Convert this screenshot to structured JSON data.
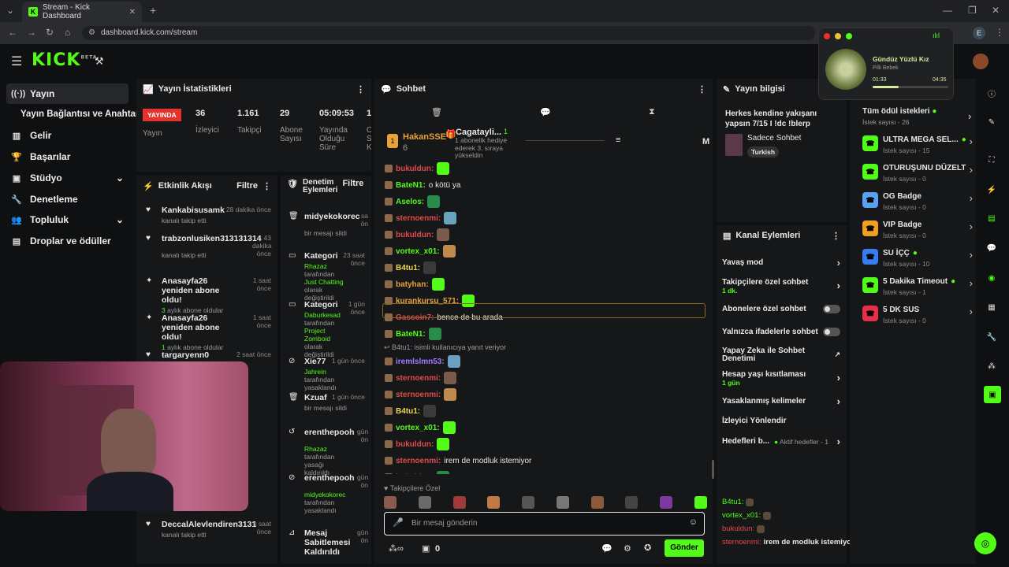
{
  "browser": {
    "tab_title": "Stream - Kick Dashboard",
    "url": "dashboard.kick.com/stream",
    "profile": "E"
  },
  "logo": {
    "text": "KICK",
    "beta": "BETA"
  },
  "sidebar": {
    "items": [
      {
        "label": "Yayın",
        "icon": "broadcast-icon"
      },
      {
        "label": "Yayın Bağlantısı ve Anahtarı",
        "icon": ""
      },
      {
        "label": "Gelir",
        "icon": "chart-icon"
      },
      {
        "label": "Başarılar",
        "icon": "trophy-icon"
      },
      {
        "label": "Stüdyo",
        "icon": "studio-icon"
      },
      {
        "label": "Denetleme",
        "icon": "wrench-icon"
      },
      {
        "label": "Topluluk",
        "icon": "users-icon"
      },
      {
        "label": "Droplar ve ödüller",
        "icon": "gift-icon"
      }
    ]
  },
  "stats": {
    "title": "Yayın İstatistikleri",
    "live": "YAYINDA",
    "live_sub": "Yayın",
    "items": [
      {
        "value": "36",
        "label": "İzleyici"
      },
      {
        "value": "1.161",
        "label": "Takipçi"
      },
      {
        "value": "29",
        "label": "Abone Sayısı"
      },
      {
        "value": "05:09:53",
        "label": "Yayında Olduğu Süre"
      },
      {
        "value": "1",
        "label": "C S K"
      }
    ]
  },
  "activity": {
    "title": "Etkinlik Akışı",
    "filter": "Filtre",
    "items": [
      {
        "name": "Kankabisusamk",
        "when": "28 dakika önce",
        "text": "kanalı takip etti",
        "type": "follow"
      },
      {
        "name": "trabzonlusiken313131314",
        "when": "43 dakika önce",
        "text": "kanalı takip etti",
        "type": "follow"
      },
      {
        "name": "Anasayfa26 yeniden abone oldu!",
        "when": "1 saat önce",
        "num": "3",
        "text": "aylık abone oldular",
        "type": "sub"
      },
      {
        "name": "Anasayfa26 yeniden abone oldu!",
        "when": "1 saat önce",
        "num": "1",
        "text": "aylık abone oldular",
        "type": "sub"
      },
      {
        "name": "targaryenn0",
        "when": "2 saat önce",
        "text": "",
        "type": "follow"
      },
      {
        "name": "DeccalAlevlendiren3131",
        "when": "4 saat önce",
        "text": "kanalı takip etti",
        "type": "follow"
      }
    ]
  },
  "moderation": {
    "title": "Denetim Eylemleri",
    "filter": "Filtre",
    "items": [
      {
        "name": "midyekokorec",
        "when": "sa ön",
        "text": "bir mesajı sildi"
      },
      {
        "name": "Kategori",
        "when": "23 saat önce",
        "actor": "Rhazaz",
        "mid": "tarafından",
        "hl": "Just Chatting",
        "tail": "olarak değiştirildi"
      },
      {
        "name": "Kategori",
        "when": "1 gün önce",
        "actor": "Daburkesad",
        "mid": "tarafından",
        "hl": "Project Zomboid",
        "tail": "olarak değiştirildi"
      },
      {
        "name": "Xie77",
        "when": "1 gün önce",
        "actor": "Jahrein",
        "tail": "tarafından yasaklandı"
      },
      {
        "name": "Kzuaf",
        "when": "1 gün önce",
        "text": "bir mesajı sildi"
      },
      {
        "name": "erenthepooh",
        "when": "gün ön",
        "actor": "Rhazaz",
        "tail": "tarafından yasağı kaldırıldı"
      },
      {
        "name": "erenthepooh",
        "when": "gün ön",
        "actor": "midyekokorec",
        "tail": "tarafından yasaklandı"
      },
      {
        "name": "Mesaj Sabitlemesi Kaldırıldı",
        "when": "gün ön",
        "text": ""
      }
    ]
  },
  "chat": {
    "title": "Sohbet",
    "pinned": {
      "user": "HakanSSE",
      "count": "6",
      "gift_user": "Cagatayli...",
      "gift_count": "1",
      "gift_text": "1 abonelik hediye ederek 3. sıraya yükseldin",
      "side": "M"
    },
    "messages": [
      {
        "user": "bukuldun",
        "color": "#e24a4a",
        "text": ""
      },
      {
        "user": "BateN1",
        "color": "#53fc18",
        "text": "o kötü ya"
      },
      {
        "user": "Aselos",
        "color": "#53fc18",
        "text": ""
      },
      {
        "user": "sternoenmi",
        "color": "#e24a4a",
        "text": ""
      },
      {
        "user": "bukuldun",
        "color": "#e24a4a",
        "text": ""
      },
      {
        "user": "vortex_x01",
        "color": "#53fc18",
        "text": ""
      },
      {
        "user": "B4tu1",
        "color": "#e8d94a",
        "text": ""
      },
      {
        "user": "batyhan",
        "color": "#e8a23a",
        "text": ""
      },
      {
        "user": "kurankursu_571",
        "color": "#e8a23a",
        "text": ""
      },
      {
        "user": "Gascoin7",
        "color": "#e24a4a",
        "text": "bence de bu arada"
      },
      {
        "user": "BateN1",
        "color": "#53fc18",
        "text": ""
      },
      {
        "user": "iremlslmn53",
        "color": "#a27cff",
        "text": ""
      },
      {
        "user": "sternoenmi",
        "color": "#e24a4a",
        "text": ""
      },
      {
        "user": "sternoenmi",
        "color": "#e24a4a",
        "text": ""
      },
      {
        "user": "B4tu1",
        "color": "#e8d94a",
        "text": ""
      },
      {
        "user": "vortex_x01",
        "color": "#53fc18",
        "text": ""
      },
      {
        "user": "bukuldun",
        "color": "#e24a4a",
        "text": ""
      },
      {
        "user": "sternoenmi",
        "color": "#e24a4a",
        "text": "irem de modluk istemiyor"
      },
      {
        "user": "bukuldun",
        "color": "#e24a4a",
        "text": ""
      }
    ],
    "reply_note": "B4tu1: isimli kullanıcıya yanıt veriyor",
    "followers_only": "Takipçilere Özel",
    "input_placeholder": "Bir mesaj gönderin",
    "points": "0",
    "send": "Gönder"
  },
  "stream_info": {
    "title": "Yayın bilgisi",
    "stream_title": "Herkes kendine yakışanı yapsın 7/15 I !dc !blerp",
    "category": "Sadece Sohbet",
    "tag": "Turkish"
  },
  "channel_actions": {
    "title": "Kanal Eylemleri",
    "items": [
      {
        "label": "Yavaş mod",
        "kind": "arrow"
      },
      {
        "label": "Takipçilere özel sohbet",
        "sub": "1 dk.",
        "kind": "arrow"
      },
      {
        "label": "Abonelere özel sohbet",
        "kind": "toggle"
      },
      {
        "label": "Yalnızca ifadelerle sohbet",
        "kind": "toggle"
      },
      {
        "label": "Yapay Zeka ile Sohbet Denetimi",
        "kind": "ext"
      },
      {
        "label": "Hesap yaşı kısıtlaması",
        "sub": "1 gün",
        "kind": "arrow"
      },
      {
        "label": "Yasaklanmış kelimeler",
        "kind": "arrow"
      },
      {
        "label": "İzleyici Yönlendir",
        "kind": "none"
      },
      {
        "label": "Hedefleri b...",
        "sub": "Aktif hedefler - 1",
        "kind": "arrow"
      }
    ]
  },
  "rewards": {
    "title": "Tüm ödül istekleri",
    "title_sub": "İstek sayısı - 26",
    "items": [
      {
        "name": "ULTRA MEGA SEL...",
        "sub": "İstek sayısı - 15",
        "color": "#53fc18",
        "dot": true
      },
      {
        "name": "OTURUŞUNU DÜZELT",
        "sub": "İstek sayısı - 0",
        "color": "#53fc18",
        "dot": false
      },
      {
        "name": "OG Badge",
        "sub": "İstek sayısı - 0",
        "color": "#5aa0f0",
        "dot": false
      },
      {
        "name": "VIP Badge",
        "sub": "İstek sayısı - 0",
        "color": "#f0a020",
        "dot": false
      },
      {
        "name": "SU İÇÇ",
        "sub": "İstek sayısı - 10",
        "color": "#3a7cf0",
        "dot": true
      },
      {
        "name": "5 Dakika Timeout",
        "sub": "İstek sayısı - 1",
        "color": "#53fc18",
        "dot": true
      },
      {
        "name": "5 DK SUS",
        "sub": "İstek sayısı - 0",
        "color": "#e0304a",
        "dot": false
      }
    ]
  },
  "music": {
    "title": "Gündüz Yüzlü Kız",
    "artist": "Pilli Bebek",
    "elapsed": "01:33",
    "total": "04:35",
    "progress": 0.34
  },
  "overlay_chat": [
    {
      "user": "B4tu1:",
      "color": "#53fc18",
      "text": ""
    },
    {
      "user": "vortex_x01:",
      "color": "#53fc18",
      "text": ""
    },
    {
      "user": "bukuldun:",
      "color": "#e24a4a",
      "text": ""
    },
    {
      "user": "sternoenmi:",
      "color": "#e24a4a",
      "text": "irem de modluk istemiyor"
    }
  ],
  "colors": {
    "accent": "#53fc18",
    "live": "#e5322d",
    "bg": "#0f1012",
    "panel": "#161719"
  }
}
